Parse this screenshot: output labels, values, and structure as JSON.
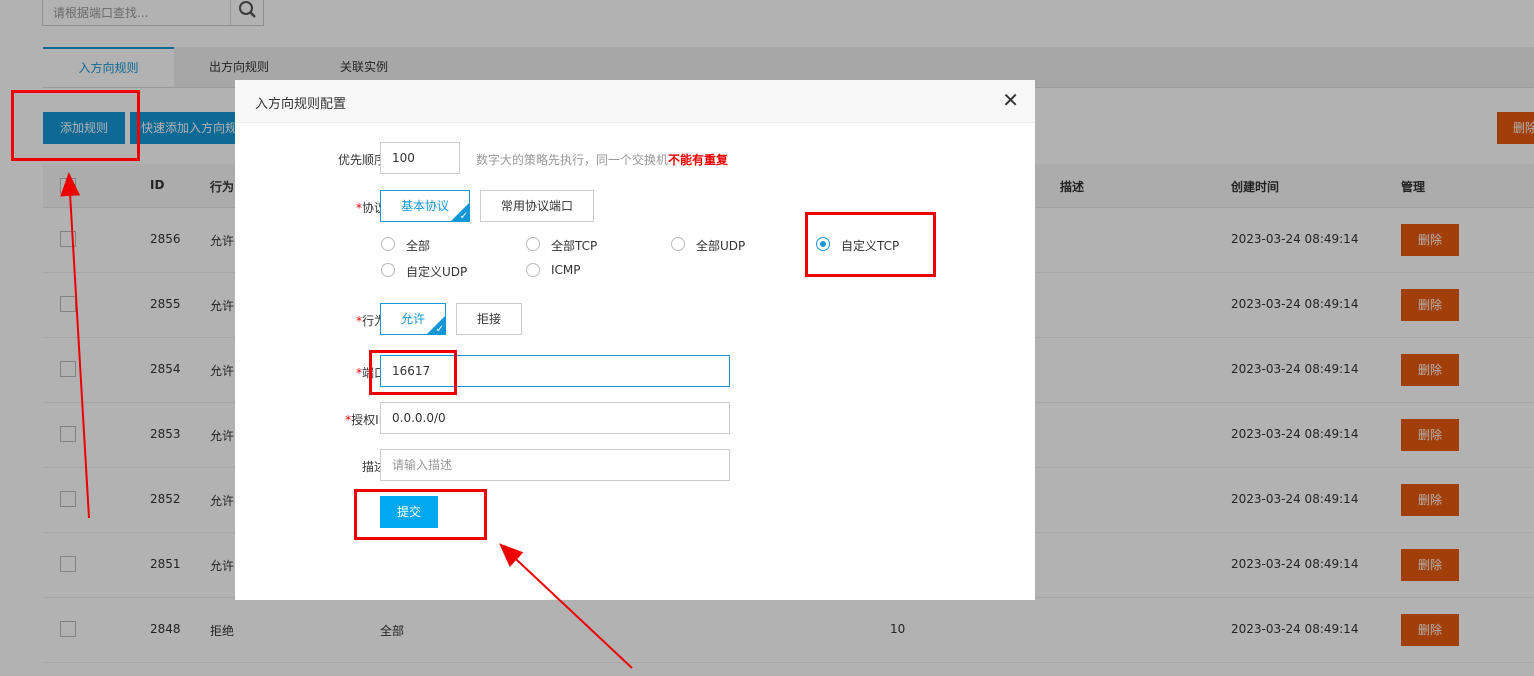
{
  "search": {
    "placeholder": "请根据端口查找..."
  },
  "tabs": [
    "入方向规则",
    "出方向规则",
    "关联实例"
  ],
  "toolbar": {
    "add_label": "添加规则",
    "quick_add_label": "快速添加入方向规则",
    "right_delete_label": "删除"
  },
  "table": {
    "headers": [
      "ID",
      "行为",
      "描述",
      "创建时间",
      "管理"
    ],
    "rows": [
      {
        "id": "2856",
        "action": "允许",
        "protocol": "",
        "port": "",
        "created": "2023-03-24 08:49:14"
      },
      {
        "id": "2855",
        "action": "允许",
        "protocol": "",
        "port": "",
        "created": "2023-03-24 08:49:14"
      },
      {
        "id": "2854",
        "action": "允许",
        "protocol": "",
        "port": "",
        "created": "2023-03-24 08:49:14"
      },
      {
        "id": "2853",
        "action": "允许",
        "protocol": "",
        "port": "",
        "created": "2023-03-24 08:49:14"
      },
      {
        "id": "2852",
        "action": "允许",
        "protocol": "",
        "port": "",
        "created": "2023-03-24 08:49:14"
      },
      {
        "id": "2851",
        "action": "允许",
        "protocol": "",
        "port": "",
        "created": "2023-03-24 08:49:14"
      },
      {
        "id": "2848",
        "action": "拒绝",
        "protocol": "全部",
        "port": "10",
        "created": "2023-03-24 08:49:14"
      }
    ],
    "delete_label": "删除"
  },
  "dialog": {
    "title": "入方向规则配置",
    "priority": {
      "label": "优先顺序:",
      "value": "100",
      "hint": "数字大的策略先执行，同一个交换机",
      "hint_strong": "不能有重复"
    },
    "protocol": {
      "label": "协议:",
      "modes": [
        "基本协议",
        "常用协议端口"
      ],
      "options": [
        "全部",
        "全部TCP",
        "全部UDP",
        "自定义TCP",
        "自定义UDP",
        "ICMP"
      ],
      "selected": "自定义TCP"
    },
    "action": {
      "label": "行为:",
      "options": [
        "允许",
        "拒接"
      ]
    },
    "port": {
      "label": "端口:",
      "value": "16617"
    },
    "auth_ip": {
      "label": "授权IP:",
      "value": "0.0.0.0/0"
    },
    "desc": {
      "label": "描述:",
      "placeholder": "请输入描述"
    },
    "submit_label": "提交",
    "required_mark": "*"
  },
  "colors": {
    "accent": "#1497d6",
    "danger": "#e8590c",
    "annotation": "#e00000"
  }
}
